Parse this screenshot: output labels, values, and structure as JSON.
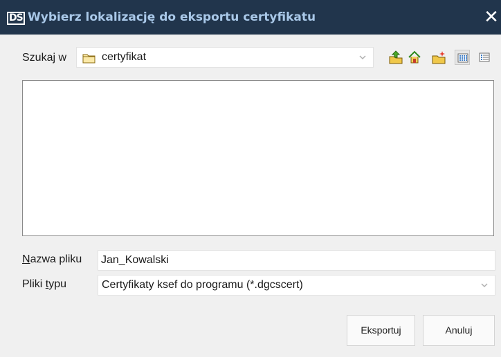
{
  "window": {
    "logo": "DS",
    "title": "Wybierz lokalizację do eksportu certyfikatu",
    "close_glyph": "✕",
    "colors": {
      "titlebar_bg": "#21354c",
      "title_fg": "#a9c8e8",
      "dialog_bg": "#f0f0f0"
    }
  },
  "look_in": {
    "label": "Szukaj w",
    "folder_icon": "folder-icon",
    "value": "certyfikat"
  },
  "toolbar": [
    {
      "name": "up-one-level-button",
      "icon": "folder-up-icon"
    },
    {
      "name": "home-button",
      "icon": "home-icon"
    },
    {
      "name": "new-folder-button",
      "icon": "new-folder-icon"
    },
    {
      "name": "list-view-button",
      "icon": "list-view-icon",
      "pressed": true
    },
    {
      "name": "details-view-button",
      "icon": "details-view-icon",
      "pressed": false
    }
  ],
  "file_name": {
    "label_mnemonic": "N",
    "label_rest": "azwa pliku",
    "value": "Jan_Kowalski"
  },
  "file_type": {
    "label_prefix": "Pliki ",
    "label_mnemonic": "t",
    "label_rest": "ypu",
    "value": "Certyfikaty ksef do programu (*.dgcscert)"
  },
  "buttons": {
    "export": "Eksportuj",
    "cancel": "Anuluj"
  }
}
